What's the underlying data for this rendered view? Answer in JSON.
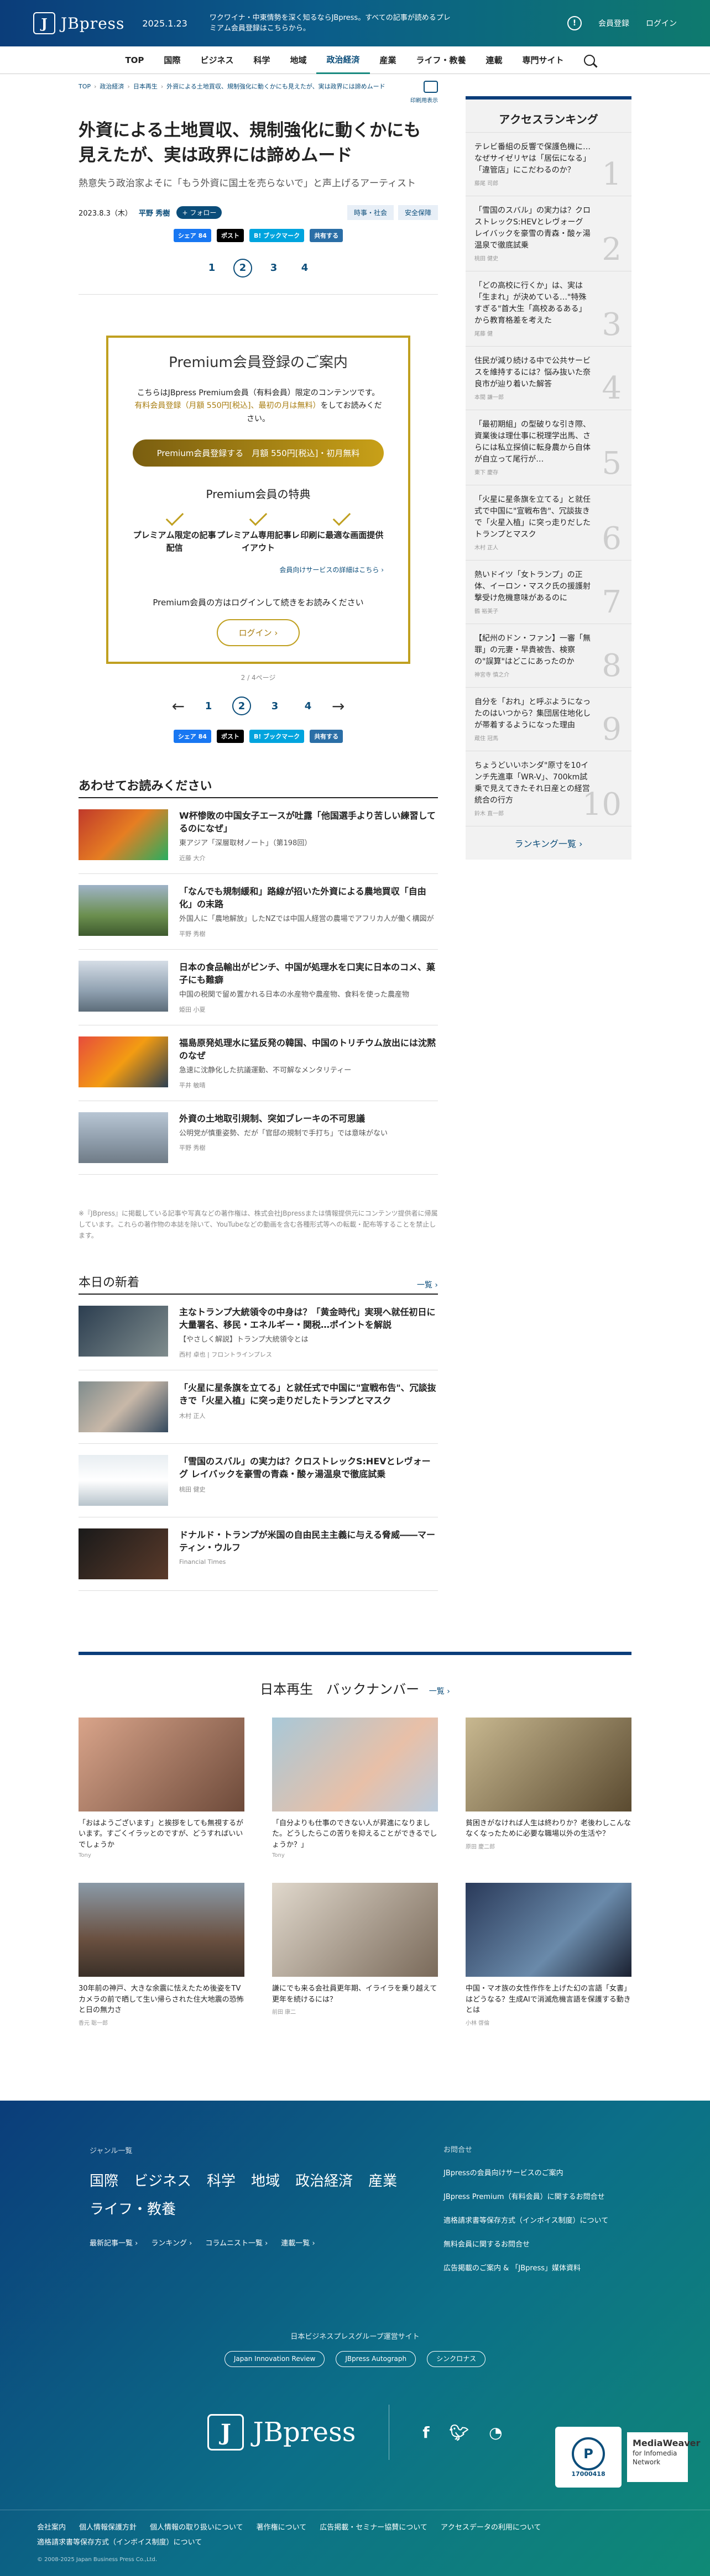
{
  "header": {
    "brand": "JBpress",
    "date": "2025.1.23",
    "promo": "ワクワイナ・中東情勢を深く知るならJBpress。すべての記事が読めるプレミアム会員登録はこちらから。",
    "register": "会員登録",
    "login": "ログイン"
  },
  "nav": {
    "items": [
      "TOP",
      "国際",
      "ビジネス",
      "科学",
      "地域",
      "政治経済",
      "産業",
      "ライフ・教養",
      "連載",
      "専門サイト"
    ],
    "active_index": 5
  },
  "breadcrumb": [
    "TOP",
    "政治経済",
    "日本再生",
    "外資による土地買収、規制強化に動くかにも見えたが、実は政界には諦めムード"
  ],
  "print_label": "印刷用表示",
  "article": {
    "title": "外資による土地買収、規制強化に動くかにも見えたが、実は政界には諦めムード",
    "subtitle": "熱意失う政治家よそに「もう外資に国土を売らないで」と声上げるアーティスト",
    "date": "2023.8.3（木）",
    "author": "平野 秀樹",
    "follow": "フォロー",
    "tags": [
      "時事・社会",
      "安全保障"
    ]
  },
  "share": {
    "fb": "シェア 84",
    "x": "ポスト",
    "hb": "B! ブックマーク",
    "pocket": "共有する"
  },
  "pager": [
    "1",
    "2",
    "3",
    "4"
  ],
  "pager_current": "2",
  "premium": {
    "title": "Premium会員登録のご案内",
    "text1": "こちらはJBpress Premium会員（有料会員）限定のコンテンツです。",
    "text_gold": "有料会員登録（月額 550円[税込]、最初の月は無料）",
    "text2": "をしてお読みください。",
    "button": "Premium会員登録する　月額 550円[税込]・初月無料",
    "benefits_title": "Premium会員の特典",
    "benefits": [
      "プレミアム限定の記事配信",
      "プレミアム専用記事レイアウト",
      "印刷に最適な画面提供"
    ],
    "details_link": "会員向けサービスの詳細はこちら",
    "login_note": "Premium会員の方はログインして続きをお読みください",
    "login_button": "ログイン"
  },
  "page_indicator": "2 / 4ページ",
  "related": {
    "title": "あわせてお読みください",
    "items": [
      {
        "title": "W杯惨敗の中国女子エースが吐露「他国選手より苦しい練習してるのになぜ」",
        "desc": "東アジア「深層取材ノート」（第198回）",
        "author": "近藤 大介"
      },
      {
        "title": "「なんでも規制緩和」路線が招いた外資による農地買収「自由化」の末路",
        "desc": "外国人に「農地解放」したNZでは中国人経営の農場でアフリカ人が働く構図が",
        "author": "平野 秀樹"
      },
      {
        "title": "日本の食品輸出がピンチ、中国が処理水を口実に日本のコメ、菓子にも難癖",
        "desc": "中国の税関で留め置かれる日本の水産物や農産物、食料を使った農産物",
        "author": "姫田 小夏"
      },
      {
        "title": "福島原発処理水に猛反発の韓国、中国のトリチウム放出には沈黙のなぜ",
        "desc": "急速に沈静化した抗議運動、不可解なメンタリティー",
        "author": "平井 敏晴"
      },
      {
        "title": "外資の土地取引規制、突如ブレーキの不可思議",
        "desc": "公明党が慎重姿勢、だが「官邸の規制で手打ち」では意味がない",
        "author": "平野 秀樹"
      }
    ]
  },
  "note": "※『JBpress』に掲載している記事や写真などの著作権は、株式会社JBpressまたは情報提供元にコンテンツ提供者に帰属しています。これらの著作物の本誌を除いて、YouTubeなどの動画を含む各種形式等への転載・配布等することを禁止します。",
  "today": {
    "title": "本日の新着",
    "more": "一覧",
    "items": [
      {
        "title": "主なトランプ大統領令の中身は？「黄金時代」実現へ就任初日に大量署名、移民・エネルギー・関税…ポイントを解説",
        "desc": "【やさしく解説】トランプ大統領令とは",
        "author": "西村 卓也 | フロントラインプレス"
      },
      {
        "title": "「火星に星条旗を立てる」と就任式で中国に\"宣戦布告\"、冗談抜きで「火星入植」に突っ走りだしたトランプとマスク",
        "desc": "",
        "author": "木村 正人"
      },
      {
        "title": "「雪国のスバル」の実力は？クロストレックS:HEVとレヴォーグ レイバックを豪雪の青森・酸ヶ湯温泉で徹底試乗",
        "desc": "",
        "author": "桃田 健史"
      },
      {
        "title": "ドナルド・トランプが米国の自由民主主義に与える脅威――マーティン・ウルフ",
        "desc": "",
        "author": "Financial Times"
      }
    ]
  },
  "ranking": {
    "title": "アクセスランキング",
    "items": [
      {
        "text": "テレビ番組の反響で保護色機に…なぜサイゼリヤは「居伝になる」「違管店」にこだわるのか？",
        "author": "藤尾 司郎"
      },
      {
        "text": "「雪国のスバル」の実力は？クロストレックS:HEVとレヴォーグ レイバックを豪雪の青森・酸ヶ湯温泉で徹底試乗",
        "author": "桃田 健史"
      },
      {
        "text": "「どの高校に行くか」は、実は「生まれ」が決めている…\"特殊すぎる\"首大生「高校あるある」から教育格差を考えた",
        "author": "尾藤 健"
      },
      {
        "text": "住民が減り続ける中で公共サービスを維持するには？悩み抜いた奈良市が辿り着いた解答",
        "author": "本間 謙一郎"
      },
      {
        "text": "「最初期組」の型破りな引き際、資業後は理仕事に税理学出馬、さらには私立探偵に転身農から自体が自立って尾行が…",
        "author": "東下 慶存"
      },
      {
        "text": "「火星に星条旗を立てる」と就任式で中国に\"宣戦布告\"、冗談抜きで「火星入植」に突っ走りだしたトランプとマスク",
        "author": "木村 正人"
      },
      {
        "text": "熱いドイツ「女トランプ」の正体、イーロン・マスク氏の援護射撃受け危機意味があるのに",
        "author": "鶴 裕美子"
      },
      {
        "text": "【紀州のドン・ファン】一審「無罪」の元妻・早貴被告、検察の\"誤算\"はどこにあったのか",
        "author": "神宮寺 慎之介"
      },
      {
        "text": "自分を「おれ」と呼ぶようになったのはいつから？集団居住地化しが帯着するようになった理由",
        "author": "蔵住 冠馬"
      },
      {
        "text": "ちょうどいいホンダ\"原寸を10インチ先進車「WR-V」、700km試乗で見えてきたそれ日産との経営統合の行方",
        "author": "鈴木 直一郎"
      }
    ],
    "more": "ランキング一覧"
  },
  "backnumber": {
    "title": "日本再生　バックナンバー",
    "more": "一覧",
    "items": [
      {
        "text": "「おはようございます」と挨拶をしても無視するがいます。すごくイラッとのですが、どうすればいいでしょうか",
        "author": "Tony"
      },
      {
        "text": "「自分よりも仕事のできない人が昇進になりました。どうしたらこの苦りを抑えることができるでしょうか？」",
        "author": "Tony"
      },
      {
        "text": "貧困きがなければ人生は終わりか？老後わしこんななくなったために必要な職場以外の生活や？",
        "author": "原田 慶二郎"
      },
      {
        "text": "30年前の神戸、大きな余震に怯えたため後姿をTVカメラの前で晒して生い帰らされた住大地震の恐怖と日の無力さ",
        "author": "香元 聡一郎"
      },
      {
        "text": "謙にでも来る会社員更年期、イライラを乗り越えて更年を続けるには？",
        "author": "前田 康二"
      },
      {
        "text": "中国・マオ族の女性作作を上げた幻の言語「女書」はどうなる？生成AIで消滅危機言語を保護する動きとは",
        "author": "小林 啓倫"
      }
    ]
  },
  "footer": {
    "genre_label": "ジャンル一覧",
    "genres": [
      "国際",
      "ビジネス",
      "科学",
      "地域",
      "政治経済",
      "産業",
      "ライフ・教養"
    ],
    "links": [
      "最新記事一覧",
      "ランキング",
      "コラムニスト一覧",
      "連載一覧"
    ],
    "right": [
      "JBpressの会員向けサービスのご案内",
      "JBpress Premium（有料会員）に関するお問合せ",
      "適格請求書等保存方式（インボイス制度）について",
      "無料会員に関するお問合せ",
      "広告掲載のご案内 & 「JBpress」媒体資料"
    ],
    "right_head": "お問合せ",
    "group_label": "日本ビジネスプレスグループ運営サイト",
    "group_sites": [
      "Japan Innovation Review",
      "JBpress Autograph",
      "シンクロナス"
    ],
    "bottom_links": [
      "会社案内",
      "個人情報保護方針",
      "個人情報の取り扱いについて",
      "著作権について",
      "広告掲載・セミナー協賛について",
      "アクセスデータの利用について",
      "適格請求書等保存方式（インボイス制度）について"
    ],
    "copyright": "© 2008-2025 Japan Business Press Co.,Ltd.",
    "privacy_num": "17000418",
    "mw_title": "MediaWeaver",
    "mw_text": "for Infomedia Network"
  },
  "colors": {
    "brand": "#0b3d7a",
    "accent": "#0e7a6e",
    "gold": "#c0a020"
  }
}
